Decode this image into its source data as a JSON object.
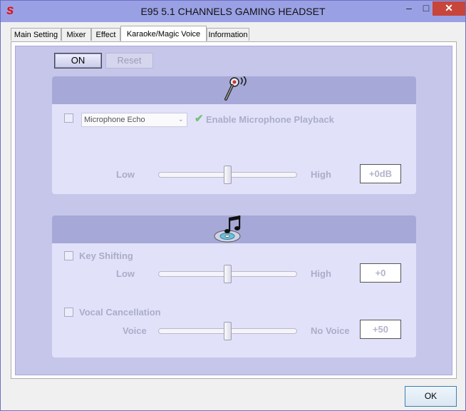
{
  "window": {
    "title": "E95 5.1 CHANNELS GAMING HEADSET",
    "logo_text": "s",
    "controls": {
      "minimize": "–",
      "maximize": "□",
      "close": "✕"
    }
  },
  "tabs": [
    {
      "label": "Main Setting",
      "active": false
    },
    {
      "label": "Mixer",
      "active": false
    },
    {
      "label": "Effect",
      "active": false
    },
    {
      "label": "Karaoke/Magic Voice",
      "active": true
    },
    {
      "label": "Information",
      "active": false
    }
  ],
  "toolbar": {
    "on_label": "ON",
    "reset_label": "Reset"
  },
  "microphone": {
    "icon": "microphone-icon",
    "select_value": "Microphone Echo",
    "playback_label": "Enable Microphone Playback",
    "slider": {
      "left_label": "Low",
      "right_label": "High",
      "value_label": "+0dB",
      "level": 0.5
    }
  },
  "music": {
    "icon": "music-cd-icon",
    "key_shifting": {
      "label": "Key Shifting",
      "slider": {
        "left_label": "Low",
        "right_label": "High",
        "value_label": "+0",
        "level": 0.5
      }
    },
    "vocal_cancellation": {
      "label": "Vocal Cancellation",
      "slider": {
        "left_label": "Voice",
        "right_label": "No Voice",
        "value_label": "+50",
        "level": 0.5
      }
    }
  },
  "footer": {
    "ok_label": "OK"
  },
  "colors": {
    "titlebar": "#9aa0e4",
    "panel_bg": "#c6c6ea",
    "group_head": "#a6a9d7",
    "group_body": "#e1e1fa",
    "disabled_text": "#abadc8",
    "logo": "#e01010"
  }
}
